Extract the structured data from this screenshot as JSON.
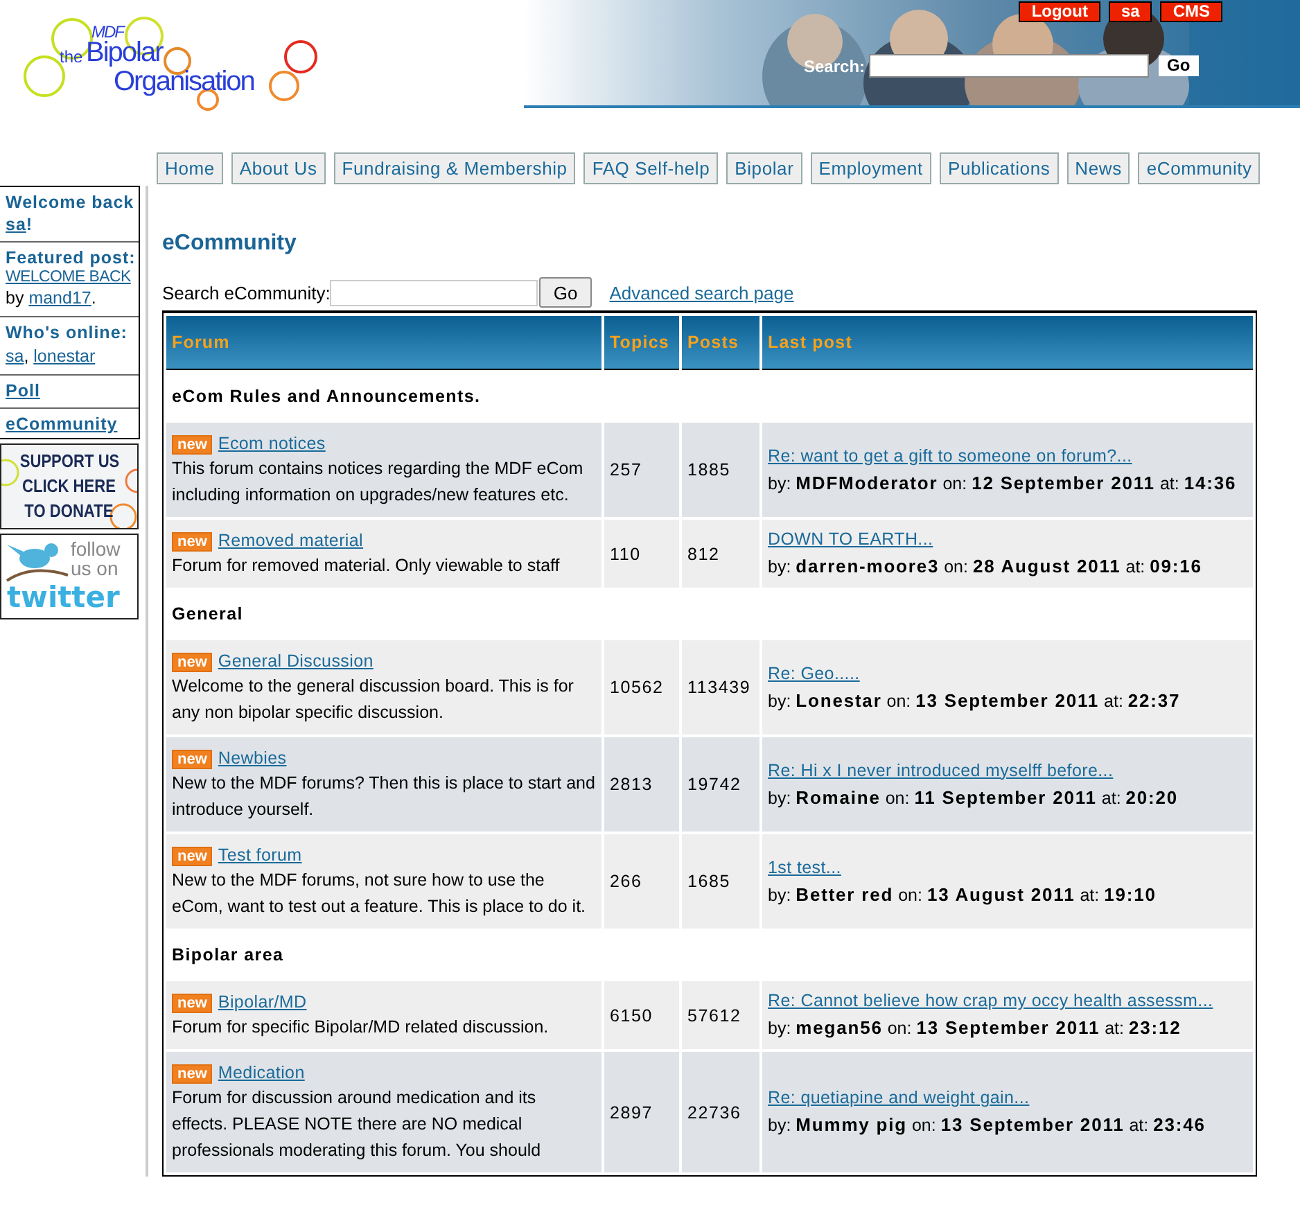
{
  "header": {
    "logo": {
      "brand": "MDF",
      "prefix": "the",
      "line1": "Bipolar",
      "line2": "Organisation"
    },
    "top_links": [
      "Logout",
      "sa",
      "CMS"
    ],
    "search": {
      "label": "Search:",
      "button": "Go"
    }
  },
  "nav": [
    "Home",
    "About Us",
    "Fundraising & Membership",
    "FAQ Self-help",
    "Bipolar",
    "Employment",
    "Publications",
    "News",
    "eCommunity"
  ],
  "sidebar": [
    {
      "kind": "welcome",
      "title": "Welcome back",
      "user": "sa",
      "end": "!"
    },
    {
      "kind": "featured",
      "title": "Featured post:",
      "link": "WELCOME BACK",
      "by": "by",
      "author": "mand17",
      "end": "."
    },
    {
      "kind": "online",
      "title": "Who's online:",
      "users": [
        "sa",
        "lonestar"
      ],
      "separator": ","
    },
    {
      "kind": "link",
      "title": "Poll"
    },
    {
      "kind": "link",
      "title": "eCommunity"
    }
  ],
  "banners": [
    {
      "kind": "donate",
      "lines": [
        "SUPPORT US",
        "CLICK HERE",
        "TO DONATE"
      ]
    },
    {
      "kind": "twitter",
      "lines": [
        "follow",
        "us on"
      ],
      "brand": "twitter"
    }
  ],
  "main": {
    "title": "eCommunity",
    "search": {
      "label": "Search eCommunity:",
      "button": "Go",
      "advanced": "Advanced search page"
    },
    "columns": [
      "Forum",
      "Topics",
      "Posts",
      "Last post"
    ],
    "sections": [
      {
        "title": "eCom Rules and Announcements.",
        "forums": [
          {
            "badge": "new",
            "name": "Ecom notices",
            "description": "This forum contains notices regarding the MDF eCom including information on upgrades/new features etc.",
            "topics": "257",
            "posts": "1885",
            "highlighted": true,
            "last_post": {
              "title": "Re: want to get a gift to someone on forum?...",
              "by": "by:",
              "author": "MDFModerator",
              "on": "on:",
              "date": "12 September 2011",
              "at": "at:",
              "time": "14:36"
            }
          },
          {
            "badge": "new",
            "name": "Removed material",
            "description": "Forum for removed material. Only viewable to staff",
            "topics": "110",
            "posts": "812",
            "highlighted": false,
            "last_post": {
              "title": "DOWN TO EARTH...",
              "by": "by:",
              "author": "darren-moore3",
              "on": "on:",
              "date": "28 August 2011",
              "at": "at:",
              "time": "09:16"
            }
          }
        ]
      },
      {
        "title": "General",
        "forums": [
          {
            "badge": "new",
            "name": "General Discussion",
            "description": "Welcome to the general discussion board. This is for any non bipolar specific discussion.",
            "topics": "10562",
            "posts": "113439",
            "highlighted": false,
            "last_post": {
              "title": "Re: Geo.....",
              "by": "by:",
              "author": "Lonestar",
              "on": "on:",
              "date": "13 September 2011",
              "at": "at:",
              "time": "22:37"
            }
          },
          {
            "badge": "new",
            "name": "Newbies",
            "description": "New to the MDF forums? Then this is place to start and introduce yourself.",
            "topics": "2813",
            "posts": "19742",
            "highlighted": true,
            "last_post": {
              "title": "Re: Hi x I never introduced myselff before...",
              "by": "by:",
              "author": "Romaine",
              "on": "on:",
              "date": "11 September 2011",
              "at": "at:",
              "time": "20:20"
            }
          },
          {
            "badge": "new",
            "name": "Test forum",
            "description": "New to the MDF forums, not sure how to use the eCom, want to test out a feature. This is place to do it.",
            "topics": "266",
            "posts": "1685",
            "highlighted": false,
            "last_post": {
              "title": "1st test...",
              "by": "by:",
              "author": "Better red",
              "on": "on:",
              "date": "13 August 2011",
              "at": "at:",
              "time": "19:10"
            }
          }
        ]
      },
      {
        "title": "Bipolar area",
        "forums": [
          {
            "badge": "new",
            "name": "Bipolar/MD",
            "description": "Forum for specific Bipolar/MD related discussion.",
            "topics": "6150",
            "posts": "57612",
            "highlighted": false,
            "last_post": {
              "title": "Re: Cannot believe how crap my occy health assessm...",
              "by": "by:",
              "author": "megan56",
              "on": "on:",
              "date": "13 September 2011",
              "at": "at:",
              "time": "23:12"
            }
          },
          {
            "badge": "new",
            "name": "Medication",
            "description": "Forum for discussion around medication and its effects. PLEASE NOTE there are NO medical professionals moderating this forum. You should",
            "topics": "2897",
            "posts": "22736",
            "highlighted": true,
            "last_post": {
              "title": "Re: quetiapine and weight gain...",
              "by": "by:",
              "author": "Mummy pig",
              "on": "on:",
              "date": "13 September 2011",
              "at": "at:",
              "time": "23:46"
            }
          }
        ]
      }
    ]
  }
}
